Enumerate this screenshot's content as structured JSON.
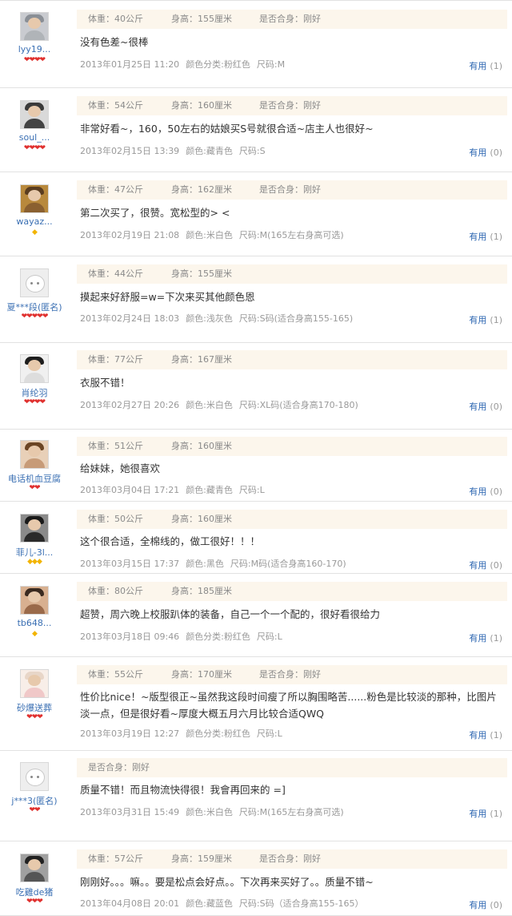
{
  "useful_label": "有用",
  "reviews": [
    {
      "user": "lyy19...",
      "rank_icon": "heart",
      "rank_count": 4,
      "weight": "体重：40公斤",
      "height": "身高：155厘米",
      "fit": "是否合身：刚好",
      "content": "没有色差~很棒",
      "date": "2013年01月25日 11:20",
      "color": "颜色分类:粉红色",
      "size": "尺码:M",
      "useful_count": "(1)",
      "avatar": {
        "hair": "#8a8f96",
        "body": "#b0b4b8",
        "bg": "#c9cbd0"
      }
    },
    {
      "user": "soul_...",
      "rank_icon": "heart",
      "rank_count": 4,
      "weight": "体重：54公斤",
      "height": "身高：160厘米",
      "fit": "是否合身：刚好",
      "content": "非常好看~，160，50左右的姑娘买S号就很合适~店主人也很好~",
      "date": "2013年02月15日 13:39",
      "color": "颜色:藏青色",
      "size": "尺码:S",
      "useful_count": "(0)",
      "avatar": {
        "hair": "#3a3a3a",
        "body": "#444444",
        "bg": "#d9d9d9"
      }
    },
    {
      "user": "wayaz...",
      "rank_icon": "diamond",
      "rank_count": 1,
      "weight": "体重：47公斤",
      "height": "身高：162厘米",
      "fit": "是否合身：刚好",
      "content": "第二次买了，很赞。宽松型的> <",
      "date": "2013年02月19日 21:08",
      "color": "颜色:米白色",
      "size": "尺码:M(165左右身高可选)",
      "useful_count": "(1)",
      "avatar": {
        "hair": "#5a3d20",
        "body": "#8a6030",
        "bg": "#b8893c"
      }
    },
    {
      "user": "夏***段(匿名)",
      "rank_icon": "heart",
      "rank_count": 5,
      "weight": "体重：44公斤",
      "height": "身高：155厘米",
      "fit": "",
      "content": "摸起来好舒服=w=下次来买其他颜色恩",
      "date": "2013年02月24日 18:03",
      "color": "颜色:浅灰色",
      "size": "尺码:S码(适合身高155-165)",
      "useful_count": "(1)",
      "avatar": "default"
    },
    {
      "user": "肖纶羽",
      "rank_icon": "heart",
      "rank_count": 4,
      "weight": "体重：77公斤",
      "height": "身高：167厘米",
      "fit": "",
      "content": "衣服不错！",
      "date": "2013年02月27日 20:26",
      "color": "颜色:米白色",
      "size": "尺码:XL码(适合身高170-180)",
      "useful_count": "(0)",
      "avatar": {
        "hair": "#1e1e1e",
        "body": "#dddddd",
        "bg": "#f0f0f0"
      }
    },
    {
      "user": "电话机血豆腐",
      "rank_icon": "heart",
      "rank_count": 2,
      "weight": "体重：51公斤",
      "height": "身高：160厘米",
      "fit": "",
      "content": "给妹妹，她很喜欢",
      "date": "2013年03月04日 17:21",
      "color": "颜色:藏青色",
      "size": "尺码:L",
      "useful_count": "(0)",
      "avatar": {
        "hair": "#6b4524",
        "body": "#c79b78",
        "bg": "#e8d0b8"
      }
    },
    {
      "user": "菲儿-3l...",
      "rank_icon": "diamond",
      "rank_count": 3,
      "weight": "体重：50公斤",
      "height": "身高：160厘米",
      "fit": "",
      "content": "这个很合适，全棉线的，做工很好！！！",
      "date": "2013年03月15日 17:37",
      "color": "颜色:黑色",
      "size": "尺码:M码(适合身高160-170)",
      "useful_count": "(0)",
      "avatar": {
        "hair": "#1a1a1a",
        "body": "#2a2a2a",
        "bg": "#8a8a8a"
      }
    },
    {
      "user": "tb648...",
      "rank_icon": "diamond",
      "rank_count": 1,
      "weight": "体重：80公斤",
      "height": "身高：185厘米",
      "fit": "",
      "content": "超赞，周六晚上校服趴体的装备，自己一个一个配的，很好看很给力",
      "date": "2013年03月18日 09:46",
      "color": "颜色分类:粉红色",
      "size": "尺码:L",
      "useful_count": "(1)",
      "avatar": {
        "hair": "#3a2a20",
        "body": "#9a6a4a",
        "bg": "#d8b090"
      }
    },
    {
      "user": "砂爆送葬",
      "rank_icon": "heart",
      "rank_count": 3,
      "weight": "体重：55公斤",
      "height": "身高：170厘米",
      "fit": "是否合身：刚好",
      "content": "性价比nice！~版型很正~虽然我这段时间瘦了所以胸围略苦......粉色是比较淡的那种，比图片淡一点，但是很好看~厚度大概五月六月比较合适QWQ",
      "date": "2013年03月19日 12:27",
      "color": "颜色分类:粉红色",
      "size": "尺码:L",
      "useful_count": "(1)",
      "avatar": {
        "hair": "#e8d6c8",
        "body": "#f0c8c8",
        "bg": "#f8eee8"
      }
    },
    {
      "user": "j***3(匿名)",
      "rank_icon": "heart",
      "rank_count": 2,
      "weight": "",
      "height": "",
      "fit": "是否合身：刚好",
      "content": "质量不错！而且物流快得很！我會再回来的 =]",
      "date": "2013年03月31日 15:49",
      "color": "颜色:米白色",
      "size": "尺码:M(165左右身高可选)",
      "useful_count": "(1)",
      "avatar": "default"
    },
    {
      "user": "吃雞de猪",
      "rank_icon": "heart",
      "rank_count": 3,
      "weight": "体重：57公斤",
      "height": "身高：159厘米",
      "fit": "是否合身：刚好",
      "content": "刚刚好。。。嘛。。要是松点会好点。。下次再来买好了。。质量不错~",
      "date": "2013年04月08日 20:01",
      "color": "颜色:藏蓝色",
      "size": "尺码:S码（适合身高155-165）",
      "useful_count": "(0)",
      "avatar": {
        "hair": "#222222",
        "body": "#555555",
        "bg": "#a0a0a0"
      }
    }
  ]
}
